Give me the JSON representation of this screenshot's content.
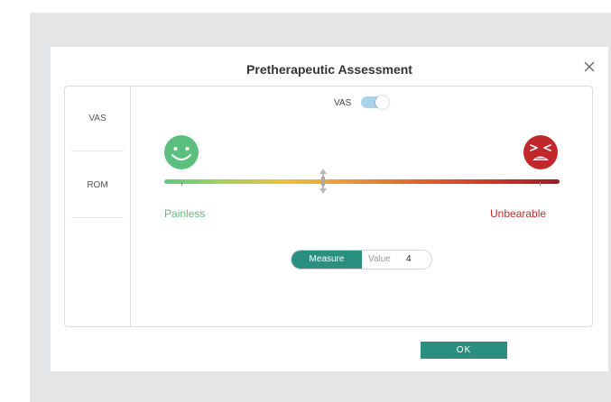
{
  "dialog": {
    "title": "Pretherapeutic Assessment",
    "ok_label": "OK"
  },
  "sidebar": {
    "items": [
      {
        "label": "VAS"
      },
      {
        "label": "ROM"
      }
    ]
  },
  "vas": {
    "toggle_label": "VAS",
    "toggle_on": true,
    "left_label": "Painless",
    "right_label": "Unbearable",
    "left_color": "#5cbf7e",
    "right_color": "#c0282c",
    "slider_value_fraction": 0.41
  },
  "measure": {
    "button_label": "Measure",
    "value_label": "Value",
    "value": "4"
  },
  "colors": {
    "accent": "#2b8f80",
    "toggle_track": "#a8d3e8",
    "happy_face": "#5cbf7e",
    "angry_face": "#c0282c"
  },
  "icons": {
    "close": "close-icon",
    "happy": "happy-face-icon",
    "angry": "angry-face-icon"
  }
}
